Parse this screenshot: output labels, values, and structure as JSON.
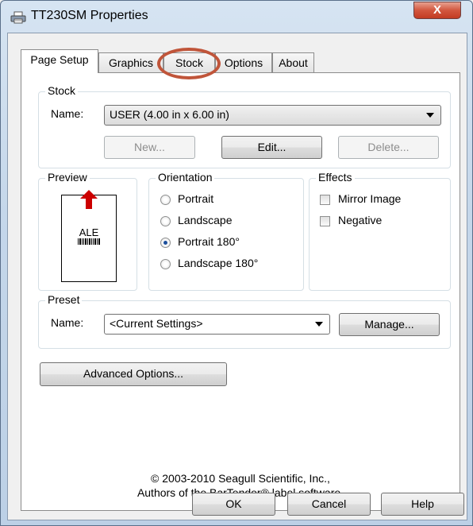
{
  "window": {
    "title": "TT230SM Properties",
    "close_label": "X"
  },
  "tabs": [
    {
      "label": "Page Setup"
    },
    {
      "label": "Graphics"
    },
    {
      "label": "Stock"
    },
    {
      "label": "Options"
    },
    {
      "label": "About"
    }
  ],
  "stock": {
    "group_label": "Stock",
    "name_label": "Name:",
    "name_value": "USER (4.00 in x 6.00 in)",
    "new_label": "New...",
    "edit_label": "Edit...",
    "delete_label": "Delete..."
  },
  "preview": {
    "group_label": "Preview",
    "sample_text": "ALE"
  },
  "orientation": {
    "group_label": "Orientation",
    "options": [
      "Portrait",
      "Landscape",
      "Portrait 180°",
      "Landscape 180°"
    ],
    "selected": "Portrait 180°"
  },
  "effects": {
    "group_label": "Effects",
    "mirror_label": "Mirror Image",
    "negative_label": "Negative"
  },
  "preset": {
    "group_label": "Preset",
    "name_label": "Name:",
    "name_value": "<Current Settings>",
    "manage_label": "Manage..."
  },
  "advanced_label": "Advanced Options...",
  "copyright": {
    "line1": "© 2003-2010 Seagull Scientific, Inc.,",
    "line2": "Authors of the BarTender® label software."
  },
  "footer": {
    "ok_label": "OK",
    "cancel_label": "Cancel",
    "help_label": "Help"
  },
  "colors": {
    "annotation": "#c0553a",
    "radio_dot": "#1c4f9c",
    "arrow": "#cc0000"
  }
}
